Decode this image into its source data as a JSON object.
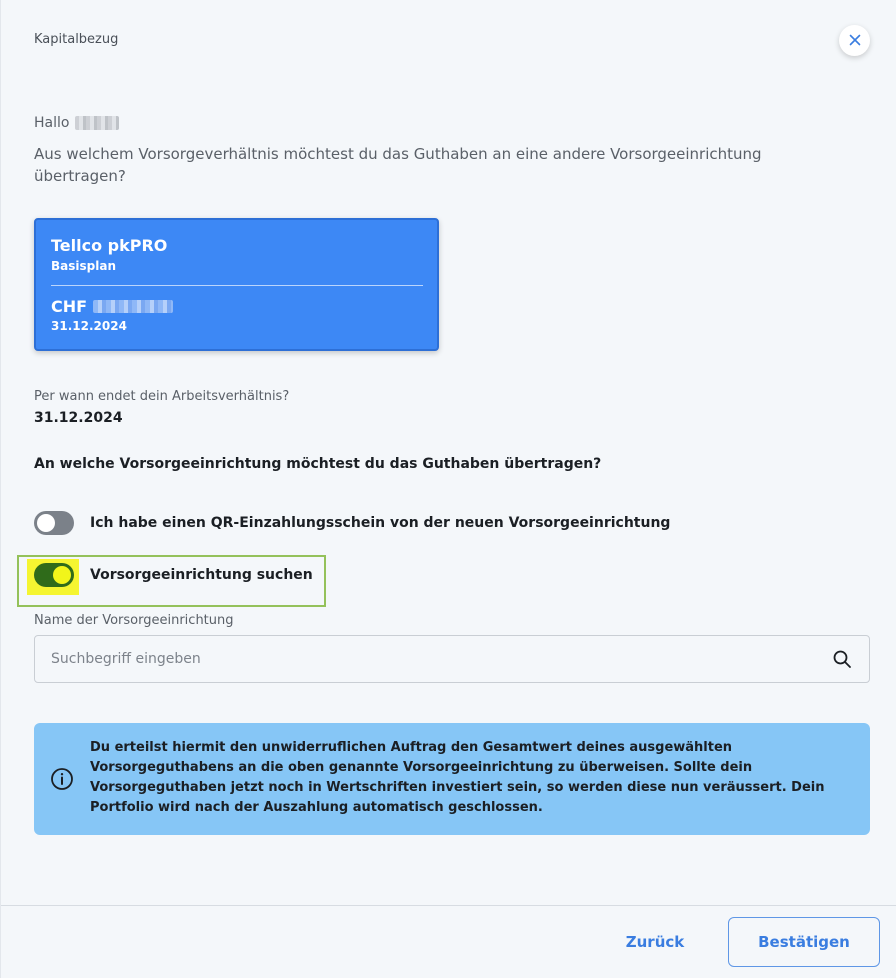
{
  "dialog": {
    "title": "Kapitalbezug",
    "close_icon": "close-icon"
  },
  "greeting": {
    "hello": "Hallo",
    "question": "Aus welchem Vorsorgeverhältnis möchtest du das Guthaben an eine andere Vorsorgeeinrichtung übertragen?"
  },
  "account_card": {
    "name": "Tellco pkPRO",
    "plan": "Basisplan",
    "currency": "CHF",
    "date": "31.12.2024",
    "color": "#3d88f5"
  },
  "employment_end": {
    "label": "Per wann endet dein Arbeitsverhältnis?",
    "value": "31.12.2024"
  },
  "transfer": {
    "question": "An welche Vorsorgeeinrichtung möchtest du das Guthaben übertragen?",
    "options": [
      {
        "label": "Ich habe einen QR-Einzahlungsschein von der neuen Vorsorgeeinrichtung",
        "enabled": false
      },
      {
        "label": "Vorsorgeeinrichtung suchen",
        "enabled": true
      }
    ]
  },
  "search": {
    "label": "Name der Vorsorgeeinrichtung",
    "placeholder": "Suchbegriff eingeben",
    "icon": "search-icon"
  },
  "info": {
    "icon": "info-icon",
    "text": "Du erteilst hiermit den unwiderruflichen Auftrag den Gesamtwert deines ausgewählten Vorsorgeguthabens an die oben genannte Vorsorgeeinrichtung zu überweisen. Sollte dein Vorsorgeguthaben jetzt noch in Wertschriften investiert sein, so werden diese nun veräussert. Dein Portfolio wird nach der Auszahlung automatisch geschlossen.",
    "background": "#86c6f6"
  },
  "footer": {
    "back_label": "Zurück",
    "confirm_label": "Bestätigen",
    "accent": "#3a7de0"
  }
}
